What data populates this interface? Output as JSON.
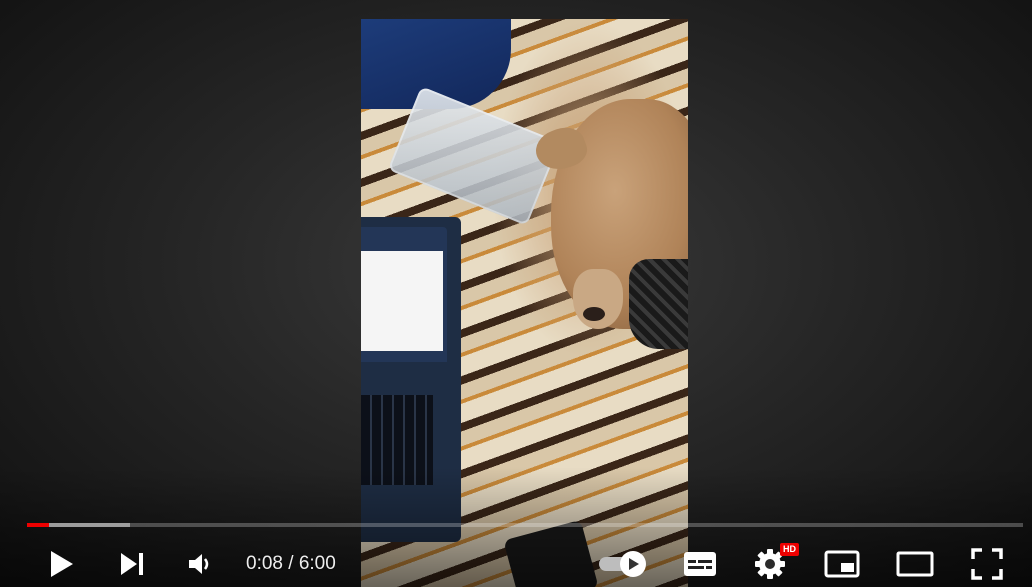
{
  "player": {
    "time": {
      "current": "0:08",
      "separator": " / ",
      "duration": "6:00"
    },
    "progress": {
      "played_fraction": 0.022,
      "buffered_fraction": 0.103
    },
    "settings_badge": "HD",
    "autoplay_enabled": true,
    "colors": {
      "progress_played": "#e00",
      "badge": "#e00",
      "icon": "#ffffff"
    },
    "icons": {
      "play": "play-icon",
      "next": "next-icon",
      "volume": "volume-icon",
      "autoplay": "autoplay-toggle-icon",
      "subtitles": "subtitles-icon",
      "settings": "gear-icon",
      "miniplayer": "miniplayer-icon",
      "theater": "theater-mode-icon",
      "fullscreen": "fullscreen-icon"
    }
  }
}
